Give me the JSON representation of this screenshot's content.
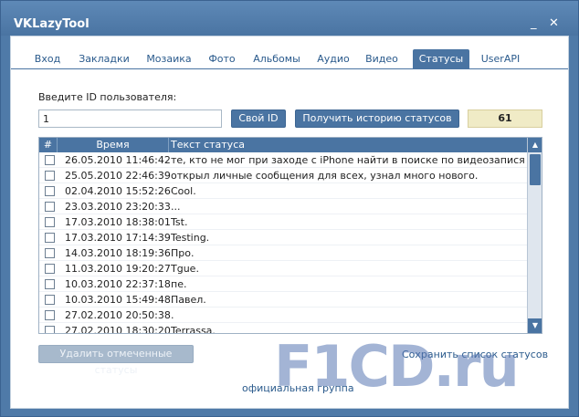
{
  "window": {
    "title": "VKLazyTool",
    "min_glyph": "_",
    "close_glyph": "✕"
  },
  "tabs": [
    {
      "label": "Вход",
      "active": false
    },
    {
      "label": "Закладки",
      "active": false
    },
    {
      "label": "Мозаика",
      "active": false
    },
    {
      "label": "Фото",
      "active": false
    },
    {
      "label": "Альбомы",
      "active": false
    },
    {
      "label": "Аудио",
      "active": false
    },
    {
      "label": "Видео",
      "active": false
    },
    {
      "label": "Статусы",
      "active": true
    },
    {
      "label": "UserAPI",
      "active": false
    }
  ],
  "form": {
    "label": "Введите ID пользователя:",
    "user_id_value": "1",
    "own_id_button": "Свой ID",
    "get_history_button": "Получить историю статусов",
    "count": "61"
  },
  "table": {
    "columns": {
      "num": "#",
      "time": "Время",
      "text": "Текст статуса"
    },
    "rows": [
      {
        "time": "26.05.2010 11:46:42",
        "text": "те, кто не мог при заходе с iPhone найти в поиске по видеозаписям гал..."
      },
      {
        "time": "25.05.2010 22:46:39",
        "text": "открыл личные сообщения для всех, узнал много нового."
      },
      {
        "time": "02.04.2010 15:52:26",
        "text": "Cool."
      },
      {
        "time": "23.03.2010 23:20:33",
        "text": "..."
      },
      {
        "time": "17.03.2010 18:38:01",
        "text": "Tst."
      },
      {
        "time": "17.03.2010 17:14:39",
        "text": "Testing."
      },
      {
        "time": "14.03.2010 18:19:36",
        "text": "Про."
      },
      {
        "time": "11.03.2010 19:20:27",
        "text": "Tgue."
      },
      {
        "time": "10.03.2010 22:37:18",
        "text": "пе."
      },
      {
        "time": "10.03.2010 15:49:48",
        "text": "Павел."
      },
      {
        "time": "27.02.2010 20:50:38",
        "text": "."
      },
      {
        "time": "27.02.2010 18:30:20",
        "text": "Terrassa."
      }
    ],
    "scroll_up_glyph": "▲",
    "scroll_down_glyph": "▼"
  },
  "actions": {
    "delete_button": "Удалить отмеченные статусы",
    "save_link": "Сохранить список статусов",
    "official_group_link": "официальная группа"
  },
  "watermark": {
    "text": "F1CD.ru"
  },
  "colors": {
    "accent": "#4a74a2",
    "count_bg": "#f0ebc6",
    "link": "#2a5a8c"
  }
}
